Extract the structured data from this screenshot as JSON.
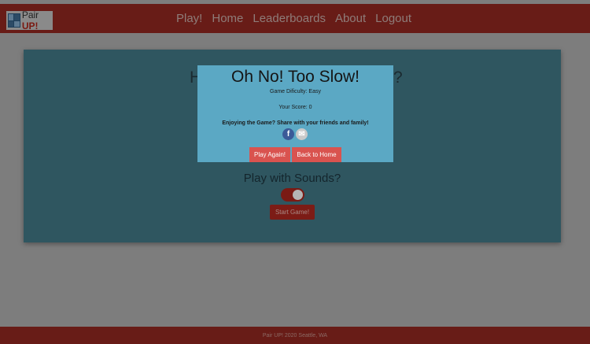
{
  "brand": {
    "logo_text_plain": "Pair ",
    "logo_text_strong": "UP!"
  },
  "nav": {
    "items": [
      "Play!",
      "Home",
      "Leaderboards",
      "About",
      "Logout"
    ]
  },
  "card": {
    "heading_left_fragment": "H",
    "heading_right_fragment": "?",
    "sounds_label": "Play with Sounds?",
    "sounds_enabled": true,
    "start_button": "Start Game!"
  },
  "modal": {
    "title": "Oh No! Too Slow!",
    "difficulty_line": "Game Dificulty: Easy",
    "score_line": "Your Score: 0",
    "share_prompt": "Enjoying the Game? Share with your friends and family!",
    "share_icons": [
      "facebook-icon",
      "mail-icon"
    ],
    "play_again_button": "Play Again!",
    "back_home_button": "Back to Home"
  },
  "footer": {
    "text": "Pair UP! 2020 Seattle, WA"
  },
  "colors": {
    "navbar": "#681c17",
    "card": "#2f5660",
    "modal": "#5ba8c4",
    "modal_button": "#d9534f",
    "facebook": "#3b5a98"
  }
}
